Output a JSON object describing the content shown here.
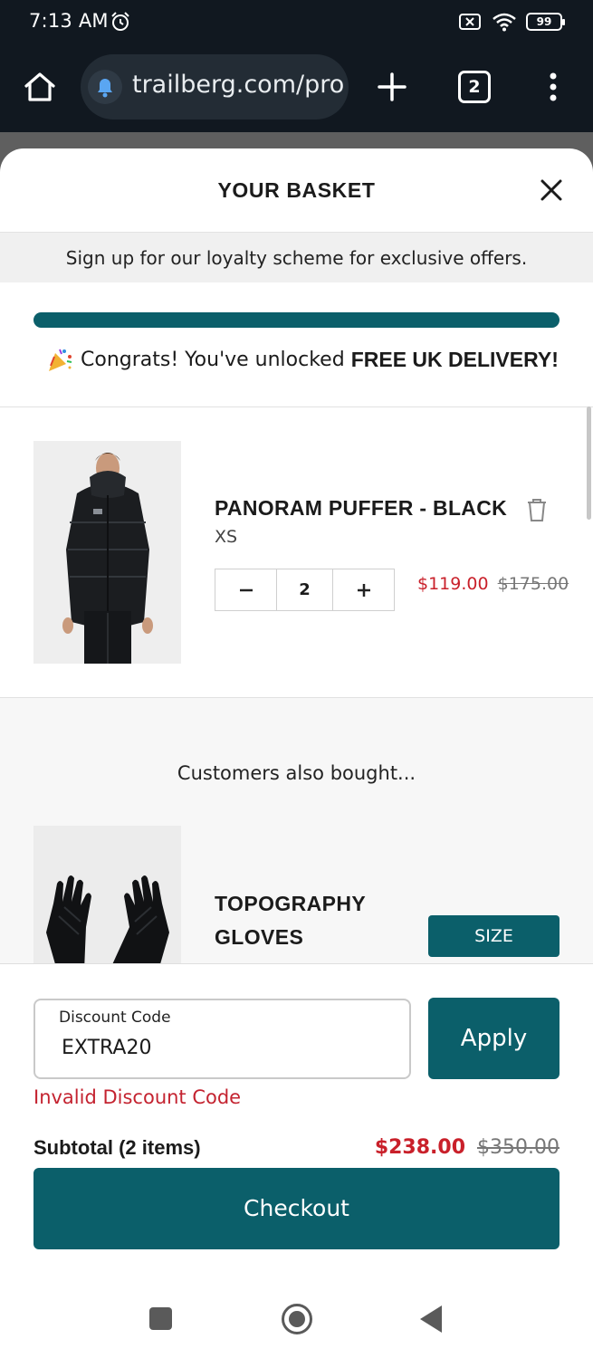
{
  "status_bar": {
    "time": "7:13 AM",
    "battery": "99"
  },
  "browser": {
    "url": "trailberg.com/pro",
    "tab_count": "2"
  },
  "basket": {
    "title": "YOUR BASKET",
    "promo_text": "Sign up for our loyalty scheme for exclusive offers.",
    "free_delivery_progress": 1.0,
    "congrats_text": "Congrats! You've unlocked",
    "congrats_bold": "FREE UK DELIVERY!"
  },
  "item": {
    "name": "PANORAM PUFFER - BLACK",
    "size": "XS",
    "quantity": "2",
    "price_now": "$119.00",
    "price_was": "$175.00"
  },
  "also_bought": {
    "title": "Customers also bought...",
    "product_name": "TOPOGRAPHY GLOVES",
    "size_button": "SIZE"
  },
  "discount": {
    "label": "Discount Code",
    "value": "EXTRA20",
    "apply_label": "Apply",
    "error": "Invalid Discount Code"
  },
  "subtotal": {
    "label": "Subtotal (2 items)",
    "now": "$238.00",
    "was": "$350.00"
  },
  "checkout_label": "Checkout",
  "colors": {
    "accent": "#0b5f6a",
    "sale_red": "#c9202a",
    "error_red": "#c42330",
    "browser_chrome": "#111820"
  }
}
